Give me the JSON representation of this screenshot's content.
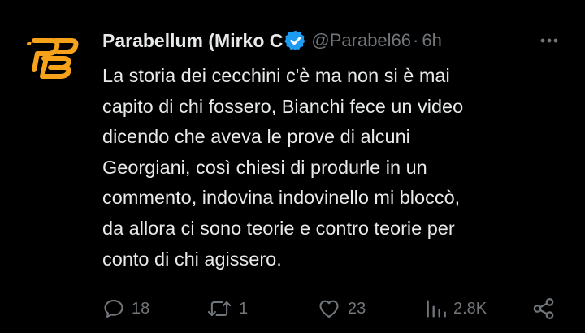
{
  "tweet": {
    "display_name": "Parabellum (Mirko C",
    "handle": "@Parabel66",
    "separator": "·",
    "time": "6h",
    "avatar_icon": "pb-logo-icon",
    "text_lines": [
      "La storia dei cecchini c'è ma non si è mai",
      "capito di chi fossero, Bianchi fece un video",
      "dicendo che aveva le prove di alcuni",
      "Georgiani, così chiesi di produrle in un",
      "commento, indovina indovinello mi bloccò,",
      "da allora ci sono teorie e contro teorie per",
      "conto di chi agissero."
    ],
    "stats": {
      "replies": "18",
      "retweets": "1",
      "likes": "23",
      "views": "2.8K"
    }
  },
  "colors": {
    "background": "#000000",
    "text": "#e7e9ea",
    "muted": "#71767b",
    "verified": "#1d9bf0",
    "logo_orange": "#f7a21b"
  }
}
